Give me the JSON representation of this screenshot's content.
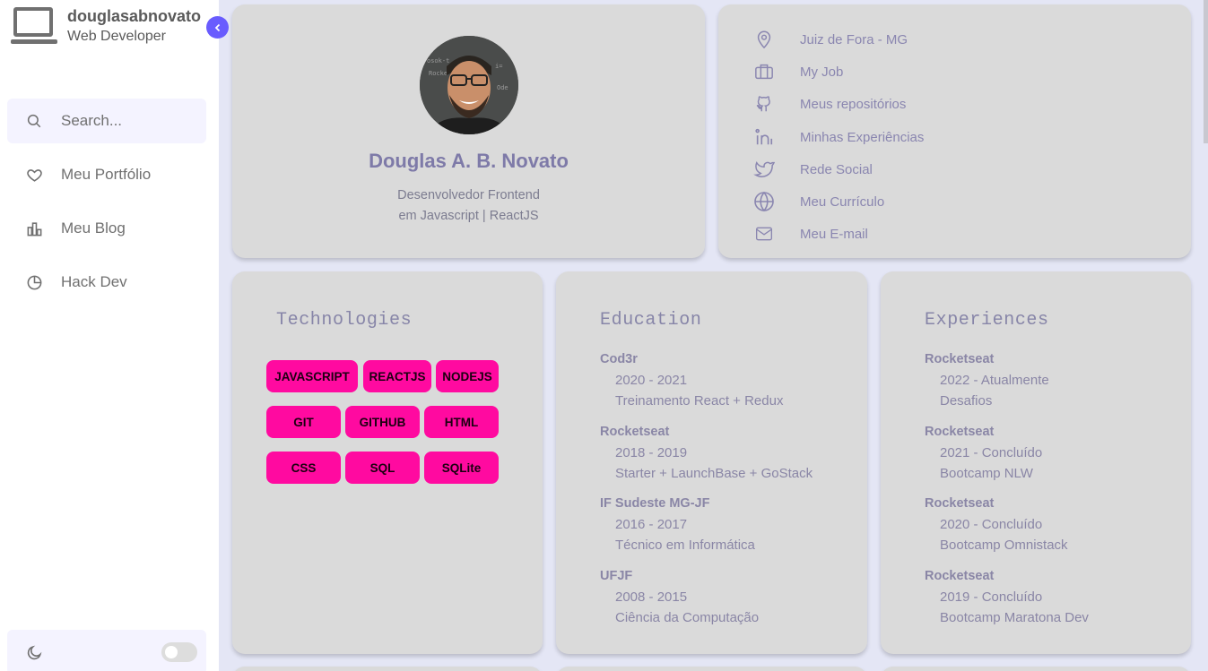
{
  "brand": {
    "name": "douglasabnovato",
    "role": "Web Developer",
    "logo_icon": "laptop-icon"
  },
  "colors": {
    "accent": "#695cfe",
    "tag": "#ff0aa0",
    "card": "#dadada",
    "text_accent": "#8a86b0"
  },
  "search": {
    "placeholder": "Search..."
  },
  "nav": [
    {
      "label": "Meu Portfólio",
      "icon": "heart-icon"
    },
    {
      "label": "Meu Blog",
      "icon": "bar-chart-icon"
    },
    {
      "label": "Hack Dev",
      "icon": "pie-chart-icon"
    }
  ],
  "mode": {
    "icon": "moon-icon",
    "dark_mode": false
  },
  "profile": {
    "name": "Douglas A. B. Novato",
    "role_line1": "Desenvolvedor Frontend",
    "role_line2": "em Javascript | ReactJS"
  },
  "links": [
    {
      "label": "Juiz de Fora - MG",
      "icon": "map-pin-icon"
    },
    {
      "label": "My Job",
      "icon": "briefcase-icon"
    },
    {
      "label": "Meus repositórios",
      "icon": "github-icon"
    },
    {
      "label": "Minhas Experiências",
      "icon": "linkedin-icon"
    },
    {
      "label": "Rede Social",
      "icon": "twitter-icon"
    },
    {
      "label": "Meu Currículo",
      "icon": "globe-icon"
    },
    {
      "label": "Meu E-mail",
      "icon": "mail-icon"
    }
  ],
  "technologies": {
    "title": "Technologies",
    "tags": [
      "JAVASCRIPT",
      "REACTJS",
      "NODEJS",
      "GIT",
      "GITHUB",
      "HTML",
      "CSS",
      "SQL",
      "SQLite"
    ]
  },
  "education": {
    "title": "Education",
    "items": [
      {
        "title": "Cod3r",
        "period": "2020 - 2021",
        "desc": "Treinamento React + Redux"
      },
      {
        "title": "Rocketseat",
        "period": "2018 - 2019",
        "desc": "Starter + LaunchBase + GoStack"
      },
      {
        "title": "IF Sudeste MG-JF",
        "period": "2016 - 2017",
        "desc": "Técnico em Informática"
      },
      {
        "title": "UFJF",
        "period": "2008 - 2015",
        "desc": "Ciência da Computação"
      }
    ]
  },
  "experiences": {
    "title": "Experiences",
    "items": [
      {
        "title": "Rocketseat",
        "period": "2022 - Atualmente",
        "desc": "Desafios"
      },
      {
        "title": "Rocketseat",
        "period": "2021 - Concluído",
        "desc": "Bootcamp NLW"
      },
      {
        "title": "Rocketseat",
        "period": "2020 - Concluído",
        "desc": "Bootcamp Omnistack"
      },
      {
        "title": "Rocketseat",
        "period": "2019 - Concluído",
        "desc": "Bootcamp Maratona Dev"
      }
    ]
  }
}
